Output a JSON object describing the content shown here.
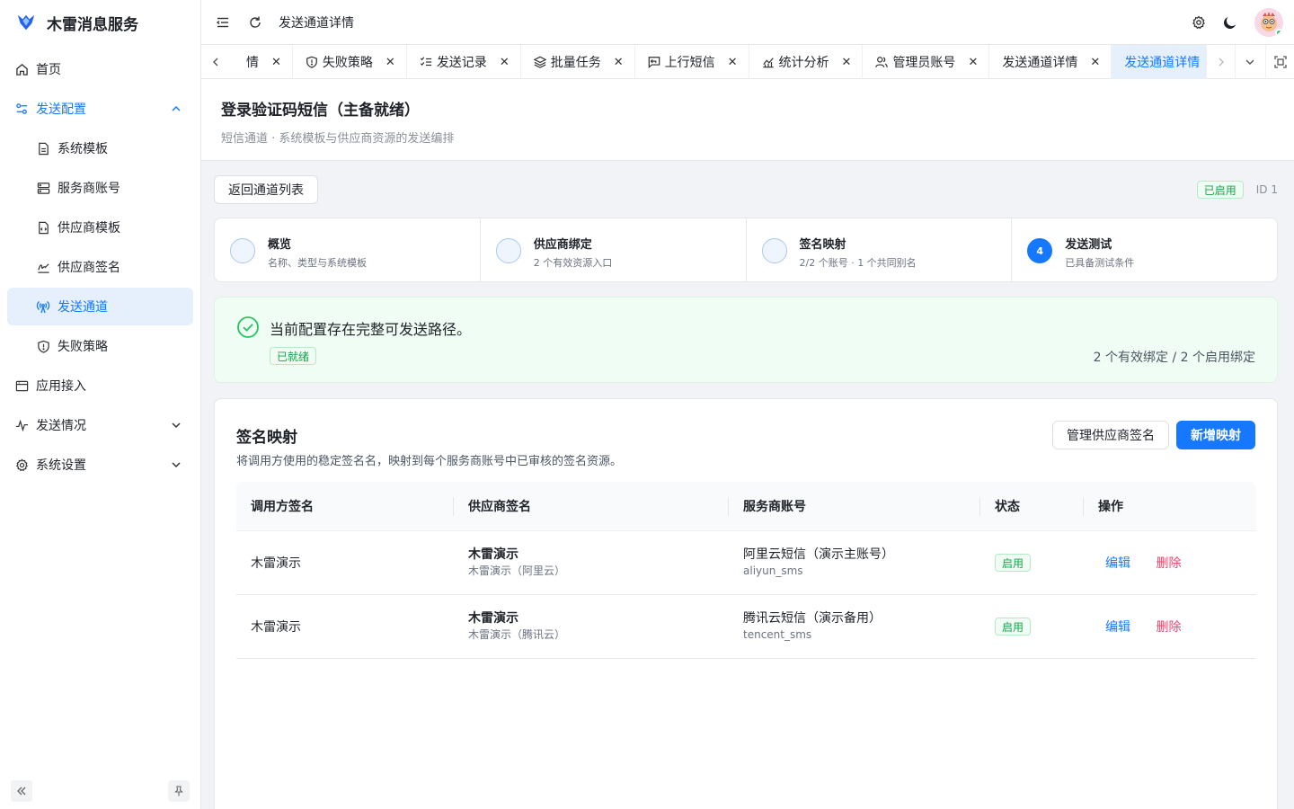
{
  "brand": {
    "title": "木雷消息服务"
  },
  "sidebar": {
    "items": [
      {
        "label": "首页",
        "icon": "home-icon"
      },
      {
        "label": "发送配置",
        "icon": "sliders-icon"
      },
      {
        "label": "系统模板",
        "icon": "document-icon"
      },
      {
        "label": "服务商账号",
        "icon": "server-icon"
      },
      {
        "label": "供应商模板",
        "icon": "file-code-icon"
      },
      {
        "label": "供应商签名",
        "icon": "signature-icon"
      },
      {
        "label": "发送通道",
        "icon": "radio-tower-icon"
      },
      {
        "label": "失败策略",
        "icon": "shield-icon"
      },
      {
        "label": "应用接入",
        "icon": "app-window-icon"
      },
      {
        "label": "发送情况",
        "icon": "activity-icon"
      },
      {
        "label": "系统设置",
        "icon": "gear-icon"
      }
    ]
  },
  "header": {
    "title": "发送通道详情"
  },
  "tabs": [
    {
      "label": "情"
    },
    {
      "label": "失败策略",
      "icon": "shield-icon"
    },
    {
      "label": "发送记录",
      "icon": "list-check-icon"
    },
    {
      "label": "批量任务",
      "icon": "layers-icon"
    },
    {
      "label": "上行短信",
      "icon": "message-reply-icon"
    },
    {
      "label": "统计分析",
      "icon": "chart-icon"
    },
    {
      "label": "管理员账号",
      "icon": "users-icon"
    },
    {
      "label": "发送通道详情"
    },
    {
      "label": "发送通道详情",
      "active": true
    }
  ],
  "page": {
    "title": "登录验证码短信（主备就绪）",
    "subtitle": "短信通道 · 系统模板与供应商资源的发送编排"
  },
  "toolbar": {
    "back_label": "返回通道列表",
    "status_tag": "已启用",
    "id_text": "ID 1"
  },
  "steps": [
    {
      "title": "概览",
      "desc": "名称、类型与系统模板"
    },
    {
      "title": "供应商绑定",
      "desc": "2 个有效资源入口"
    },
    {
      "title": "签名映射",
      "desc": "2/2 个账号 · 1 个共同别名"
    },
    {
      "number": "4",
      "title": "发送测试",
      "desc": "已具备测试条件"
    }
  ],
  "ready": {
    "message": "当前配置存在完整可发送路径。",
    "tag": "已就绪",
    "count": "2 个有效绑定 / 2 个启用绑定"
  },
  "mapping": {
    "title": "签名映射",
    "subtitle": "将调用方使用的稳定签名名，映射到每个服务商账号中已审核的签名资源。",
    "manage_label": "管理供应商签名",
    "add_label": "新增映射",
    "columns": [
      "调用方签名",
      "供应商签名",
      "服务商账号",
      "状态",
      "操作"
    ],
    "rows": [
      {
        "caller_sign": "木雷演示",
        "provider_sign": "木雷演示",
        "provider_sign_sub": "木雷演示（阿里云）",
        "account": "阿里云短信（演示主账号）",
        "account_code": "aliyun_sms",
        "status": "启用",
        "edit": "编辑",
        "delete": "删除"
      },
      {
        "caller_sign": "木雷演示",
        "provider_sign": "木雷演示",
        "provider_sign_sub": "木雷演示（腾讯云）",
        "account": "腾讯云短信（演示备用）",
        "account_code": "tencent_sms",
        "status": "启用",
        "edit": "编辑",
        "delete": "删除"
      }
    ]
  },
  "colors": {
    "primary": "#1677ff",
    "success": "#16a34a",
    "danger": "#ef4470"
  }
}
